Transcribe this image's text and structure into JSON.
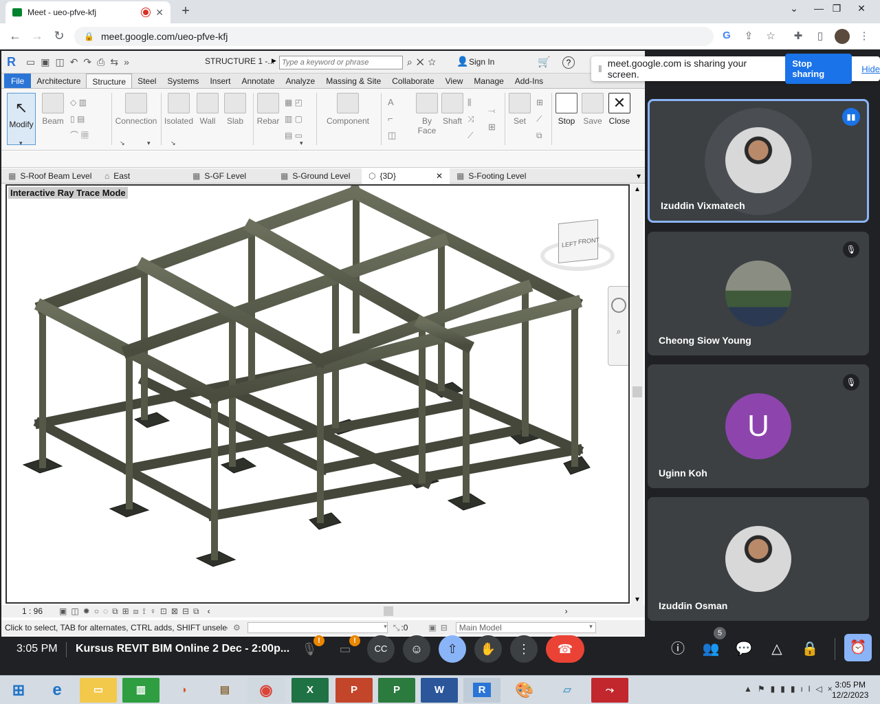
{
  "browser": {
    "tab_title": "Meet - ueo-pfve-kfj",
    "url": "meet.google.com/ueo-pfve-kfj",
    "new_tab": "+"
  },
  "revit": {
    "title": "STRUCTURE 1 -...",
    "search_placeholder": "Type a keyword or phrase",
    "sign_in": "Sign In",
    "tabs": [
      "File",
      "Architecture",
      "Structure",
      "Steel",
      "Systems",
      "Insert",
      "Annotate",
      "Analyze",
      "Massing & Site",
      "Collaborate",
      "View",
      "Manage",
      "Add-Ins"
    ],
    "active_tab": "Structure",
    "ribbon_buttons": {
      "modify": "Modify",
      "beam": "Beam",
      "connection": "Connection",
      "isolated": "Isolated",
      "wall": "Wall",
      "slab": "Slab",
      "rebar": "Rebar",
      "component": "Component",
      "by": "By",
      "face": "Face",
      "shaft": "Shaft",
      "set": "Set",
      "stop": "Stop",
      "save": "Save",
      "close": "Close"
    },
    "view_tabs": [
      "S-Roof Beam Level",
      "East",
      "S-GF Level",
      "S-Ground Level",
      "{3D}",
      "S-Footing Level"
    ],
    "ray_trace_label": "Interactive Ray Trace Mode",
    "viewcube_left": "LEFT",
    "viewcube_front": "FRONT",
    "scale": "1 : 96",
    "status_text": "Click to select, TAB for alternates, CTRL adds, SHIFT unselects.",
    "status_count": ":0",
    "main_model": "Main Model"
  },
  "share_banner": {
    "message": "meet.google.com is sharing your screen.",
    "stop": "Stop sharing",
    "hide": "Hide"
  },
  "participants": [
    {
      "name": "Izuddin Vixmatech",
      "speaking": true
    },
    {
      "name": "Cheong Siow Young",
      "muted": true
    },
    {
      "name": "Uginn Koh",
      "initial": "U",
      "muted": true
    },
    {
      "name": "Izuddin Osman",
      "muted": false
    }
  ],
  "meet": {
    "time": "3:05 PM",
    "meeting_title": "Kursus REVIT BIM Online 2 Dec - 2:00p...",
    "people_count": "5"
  },
  "taskbar": {
    "time": "3:05 PM",
    "date": "12/2/2023"
  },
  "colors": {
    "meet_blue": "#1a73e8",
    "hangup_red": "#ea4335",
    "file_tab": "#2b75d6",
    "avatar_purple": "#8e44ad"
  }
}
